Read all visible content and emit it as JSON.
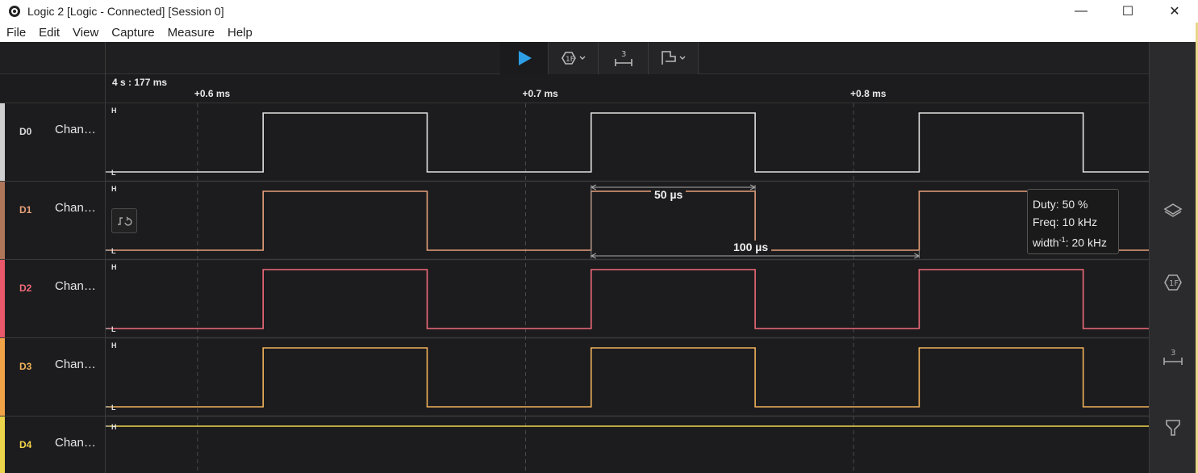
{
  "window": {
    "title": "Logo Logic 2 [Logic - Connected] [Session 0]",
    "title_text": "Logic 2 [Logic - Connected] [Session 0]",
    "minimize_glyph": "—",
    "maximize_glyph": "☐",
    "close_glyph": "✕"
  },
  "menu": [
    "File",
    "Edit",
    "View",
    "Capture",
    "Measure",
    "Help"
  ],
  "toolbar": {
    "icons": [
      "play-icon",
      "trigger-icon",
      "timing-marker-icon",
      "annotation-icon"
    ]
  },
  "timeline": {
    "origin_label": "4 s : 177 ms",
    "ticks": [
      {
        "label": "+0.6 ms",
        "ms": 0.6
      },
      {
        "label": "+0.7 ms",
        "ms": 0.7
      },
      {
        "label": "+0.8 ms",
        "ms": 0.8
      }
    ]
  },
  "channels": [
    {
      "id": "D0",
      "name": "Chan…",
      "color": "#e0e0e0",
      "stripe": "#cfcfcf"
    },
    {
      "id": "D1",
      "name": "Chan…",
      "color": "#e6a07a",
      "stripe": "#b0765a"
    },
    {
      "id": "D2",
      "name": "Chan…",
      "color": "#f06a7a",
      "stripe": "#e8586a"
    },
    {
      "id": "D3",
      "name": "Chan…",
      "color": "#f2b25a",
      "stripe": "#f0a347"
    },
    {
      "id": "D4",
      "name": "Chan…",
      "color": "#f2d34a",
      "stripe": "#ecd44a"
    }
  ],
  "levels": {
    "high": "H",
    "low": "L"
  },
  "waveform": {
    "view_start_ms": 0.572,
    "view_end_ms": 0.89,
    "first_rising_ms": 0.62,
    "period_ms": 0.1,
    "duty": 0.5
  },
  "measurements": {
    "pulse_width": "50 µs",
    "period": "100 µs",
    "duty": "Duty: 50 %",
    "freq": "Freq: 10 kHz",
    "width_inv_prefix": "width",
    "width_inv_sup": "-1",
    "width_inv_suffix": ": 20 kHz"
  },
  "sidebar": {
    "icons": [
      "analyzers-icon",
      "trigger-icon",
      "timing-marker-icon",
      "annotation-icon"
    ]
  }
}
